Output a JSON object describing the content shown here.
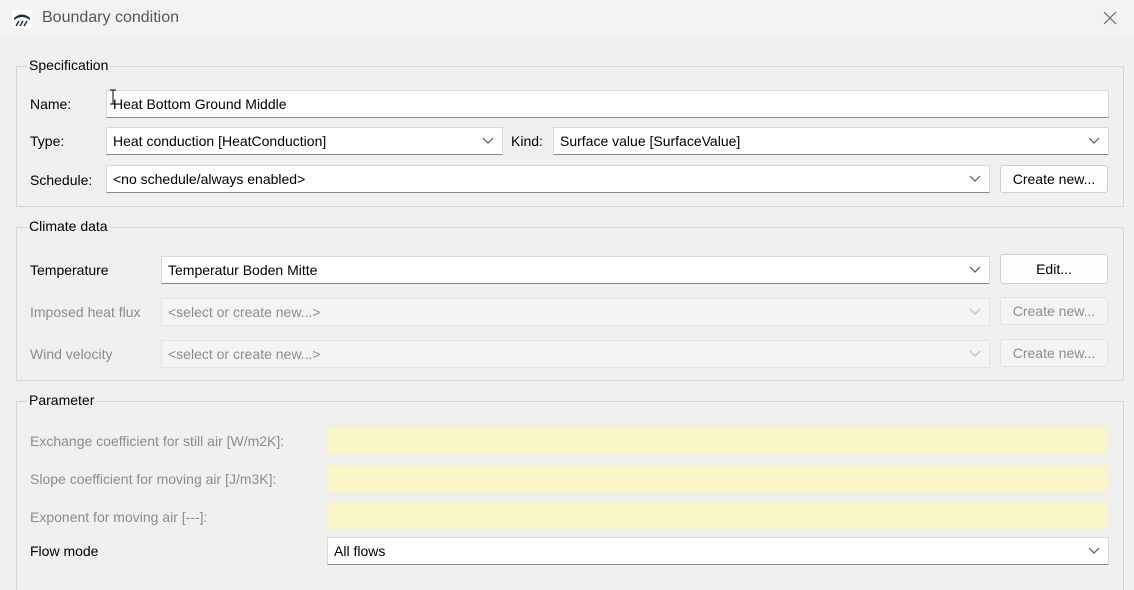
{
  "window": {
    "title": "Boundary condition",
    "app_icon": "water-surface-icon",
    "close_icon": "close-icon"
  },
  "specification": {
    "legend": "Specification",
    "name_label": "Name:",
    "name_value": "Heat Bottom Ground Middle",
    "type_label": "Type:",
    "type_value": "Heat conduction [HeatConduction]",
    "kind_label": "Kind:",
    "kind_value": "Surface value [SurfaceValue]",
    "schedule_label": "Schedule:",
    "schedule_value": "<no schedule/always enabled>",
    "schedule_button": "Create new..."
  },
  "climate": {
    "legend": "Climate data",
    "temperature_label": "Temperature",
    "temperature_value": "Temperatur Boden Mitte",
    "temperature_button": "Edit...",
    "heat_flux_label": "Imposed heat flux",
    "heat_flux_value": "<select or create new...>",
    "heat_flux_button": "Create new...",
    "wind_label": "Wind velocity",
    "wind_value": "<select or create new...>",
    "wind_button": "Create new..."
  },
  "parameter": {
    "legend": "Parameter",
    "still_air_label": "Exchange coefficient for still air [W/m2K]:",
    "still_air_value": "",
    "moving_air_label": "Slope coefficient for moving air [J/m3K]:",
    "moving_air_value": "",
    "exponent_label": "Exponent for moving air [---]:",
    "exponent_value": "",
    "flow_mode_label": "Flow mode",
    "flow_mode_value": "All flows"
  }
}
